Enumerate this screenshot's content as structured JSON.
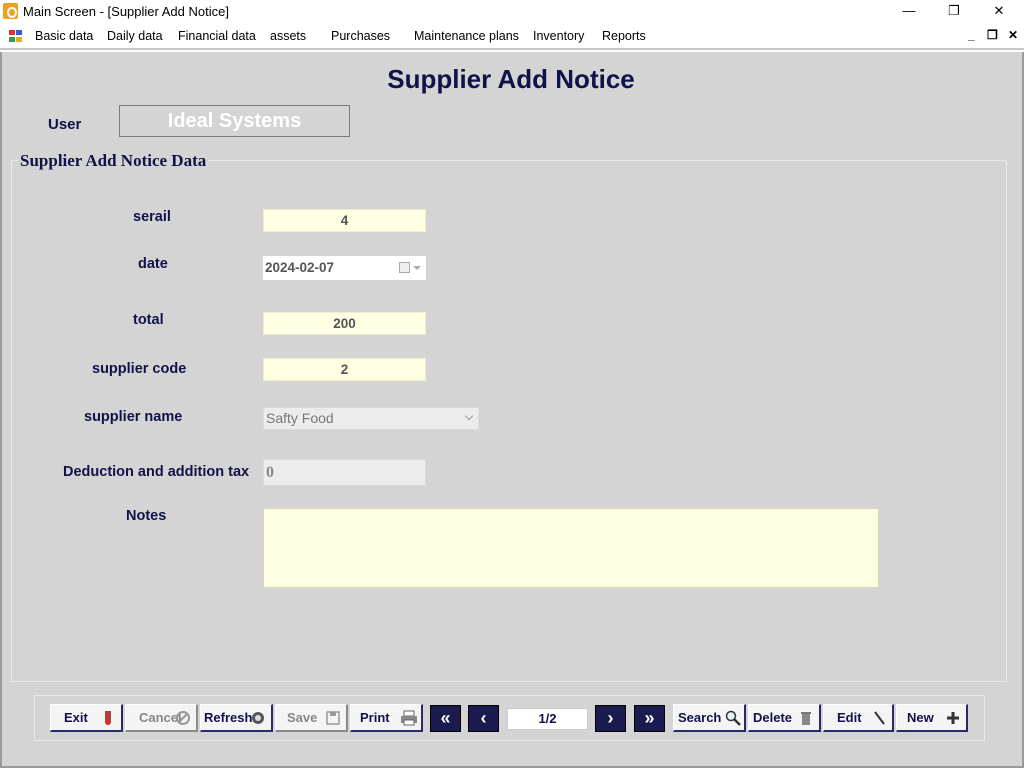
{
  "window": {
    "title": "Main Screen - [Supplier Add Notice]",
    "minimize": "—",
    "restore": "❐",
    "close": "✕"
  },
  "menu": {
    "items": [
      "Basic data",
      "Daily data",
      "Financial data",
      "assets",
      "Purchases",
      "Maintenance plans",
      "Inventory",
      "Reports"
    ],
    "mdi_minimize": "_",
    "mdi_restore": "❐",
    "mdi_close": "✕"
  },
  "form": {
    "title": "Supplier Add Notice",
    "user_label": "User",
    "user_value": "Ideal Systems",
    "group_title": "Supplier Add Notice Data",
    "fields": {
      "serail_label": "serail",
      "serail_value": "4",
      "date_label": "date",
      "date_value": "2024-02-07",
      "total_label": "total",
      "total_value": "200",
      "supplier_code_label": "supplier code",
      "supplier_code_value": "2",
      "supplier_name_label": "supplier name",
      "supplier_name_value": "Safty Food",
      "tax_label": "Deduction and addition tax",
      "tax_value": "0",
      "notes_label": "Notes",
      "notes_value": ""
    }
  },
  "toolbar": {
    "exit": "Exit",
    "cancel": "Cancel",
    "refresh": "Refresh",
    "save": "Save",
    "print": "Print",
    "first": "«",
    "prev": "‹",
    "pager": "1/2",
    "next": "›",
    "last": "»",
    "search": "Search",
    "delete": "Delete",
    "edit": "Edit",
    "new": "New"
  },
  "colors": {
    "background": "#d4d4d4",
    "label_text": "#12124a",
    "field_bg": "#fefee2",
    "nav_button": "#1a1a4e"
  },
  "icons": {
    "app": "app-logo-icon",
    "menu": "app-menu-icon",
    "exit": "exit-icon",
    "cancel": "cancel-icon",
    "refresh": "refresh-icon",
    "save": "save-icon",
    "print": "printer-icon",
    "search": "magnifier-icon",
    "delete": "trash-icon",
    "edit": "pencil-icon",
    "new": "plus-icon",
    "calendar": "calendar-icon"
  }
}
